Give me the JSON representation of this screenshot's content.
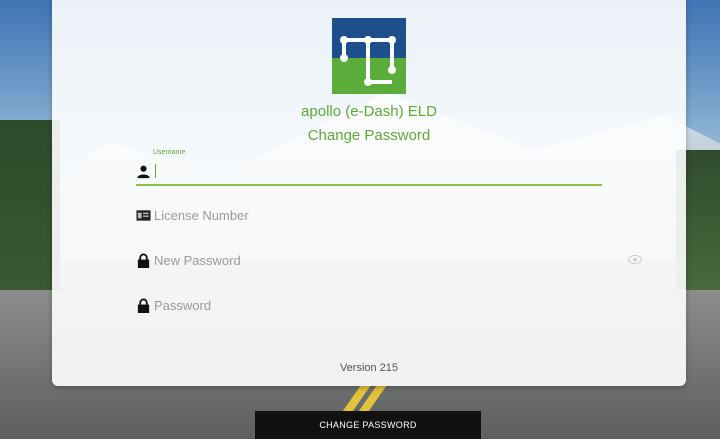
{
  "app": {
    "title": "apollo (e-Dash) ELD",
    "subtitle": "Change Password",
    "version": "Version 215"
  },
  "form": {
    "username": {
      "floating_label": "Username",
      "value": "",
      "icon": "person-icon"
    },
    "license": {
      "placeholder": "License Number",
      "icon": "id-card-icon"
    },
    "new_password": {
      "placeholder": "New Password",
      "icon": "lock-icon"
    },
    "password": {
      "placeholder": "Password",
      "icon": "lock-icon"
    }
  },
  "actions": {
    "submit_label": "CHANGE PASSWORD"
  },
  "colors": {
    "accent": "#5da83b",
    "logo_blue": "#1f4e8c",
    "logo_green": "#5aac3b",
    "button": "#111111"
  }
}
